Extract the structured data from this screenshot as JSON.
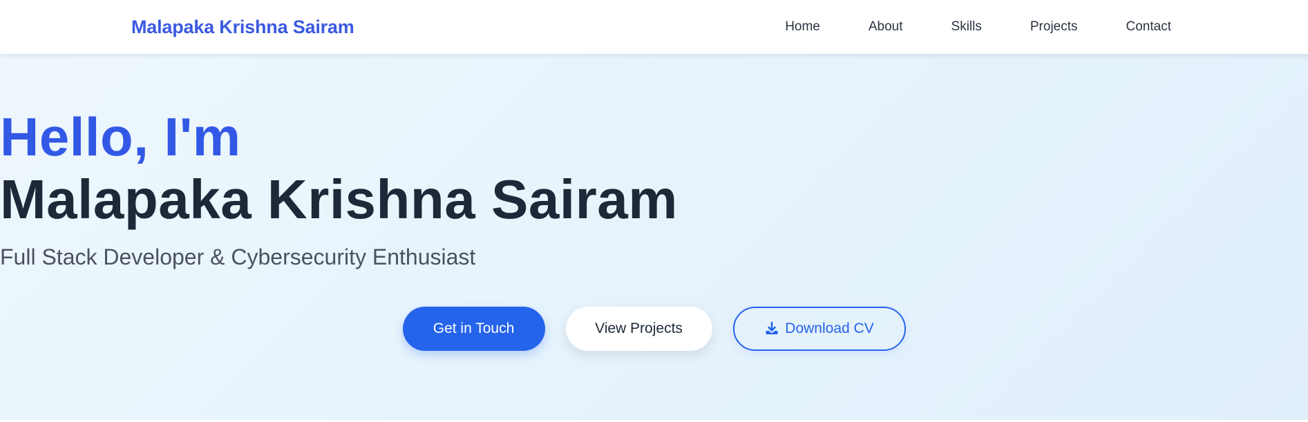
{
  "header": {
    "brand": "Malapaka Krishna Sairam",
    "nav": [
      {
        "label": "Home"
      },
      {
        "label": "About"
      },
      {
        "label": "Skills"
      },
      {
        "label": "Projects"
      },
      {
        "label": "Contact"
      }
    ]
  },
  "hero": {
    "greeting": "Hello, I'm",
    "name": "Malapaka Krishna Sairam",
    "tagline": "Full Stack Developer & Cybersecurity Enthusiast",
    "buttons": {
      "contact": "Get in Touch",
      "projects": "View Projects",
      "cv": "Download CV",
      "cv_icon": "download-icon"
    }
  },
  "colors": {
    "brand": "#3a5ae0",
    "accent": "#2563eb",
    "heading": "#1d2938"
  }
}
